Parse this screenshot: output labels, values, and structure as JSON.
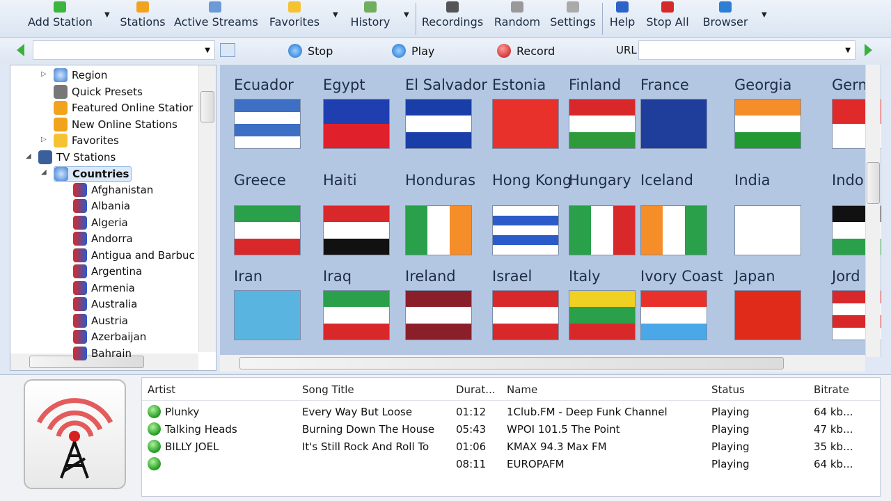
{
  "toolbar": {
    "items": [
      {
        "label": "Add Station",
        "icon": "add-icon",
        "color": "#3bb53b",
        "dropdown": true
      },
      {
        "label": "Stations",
        "icon": "stations-icon",
        "color": "#f2a31e",
        "dropdown": false
      },
      {
        "label": "Active Streams",
        "icon": "list-icon",
        "color": "#6a9ad8",
        "dropdown": false
      },
      {
        "label": "Favorites",
        "icon": "star-icon",
        "color": "#f5c232",
        "dropdown": true
      },
      {
        "label": "History",
        "icon": "history-icon",
        "color": "#6fae5c",
        "dropdown": true
      },
      {
        "label": "Recordings",
        "icon": "recordings-icon",
        "color": "#555555",
        "dropdown": false
      },
      {
        "label": "Random",
        "icon": "random-icon",
        "color": "#999999",
        "dropdown": false
      },
      {
        "label": "Settings",
        "icon": "wrench-icon",
        "color": "#aaaaaa",
        "dropdown": false
      },
      {
        "label": "Help",
        "icon": "help-icon",
        "color": "#2b63c8",
        "dropdown": false
      },
      {
        "label": "Stop All",
        "icon": "stop-icon",
        "color": "#d42a2a",
        "dropdown": false
      },
      {
        "label": "Browser",
        "icon": "ie-icon",
        "color": "#2d7fd6",
        "dropdown": true
      }
    ]
  },
  "player": {
    "stop": "Stop",
    "play": "Play",
    "record": "Record",
    "url_label": "URL",
    "url_value": "",
    "station_value": ""
  },
  "tree": [
    {
      "label": "Region",
      "level": 2,
      "icon": "globe-icon",
      "expander": "collapsed"
    },
    {
      "label": "Quick Presets",
      "level": 2,
      "icon": "presets-icon"
    },
    {
      "label": "Featured Online Statior",
      "level": 2,
      "icon": "stations-icon"
    },
    {
      "label": "New Online Stations",
      "level": 2,
      "icon": "stations-icon"
    },
    {
      "label": "Favorites",
      "level": 2,
      "icon": "star-icon",
      "expander": "collapsed"
    },
    {
      "label": "TV Stations",
      "level": 1,
      "icon": "monitor-icon",
      "expander": "expanded"
    },
    {
      "label": "Countries",
      "level": 2,
      "icon": "globe-icon",
      "expander": "expanded",
      "selected": true
    },
    {
      "label": "Afghanistan",
      "level": 3,
      "icon": "flag-icon"
    },
    {
      "label": "Albania",
      "level": 3,
      "icon": "flag-icon"
    },
    {
      "label": "Algeria",
      "level": 3,
      "icon": "flag-icon"
    },
    {
      "label": "Andorra",
      "level": 3,
      "icon": "flag-icon"
    },
    {
      "label": "Antigua and Barbuc",
      "level": 3,
      "icon": "flag-icon"
    },
    {
      "label": "Argentina",
      "level": 3,
      "icon": "flag-icon"
    },
    {
      "label": "Armenia",
      "level": 3,
      "icon": "flag-icon"
    },
    {
      "label": "Australia",
      "level": 3,
      "icon": "flag-icon"
    },
    {
      "label": "Austria",
      "level": 3,
      "icon": "flag-icon"
    },
    {
      "label": "Azerbaijan",
      "level": 3,
      "icon": "flag-icon"
    },
    {
      "label": "Bahrain",
      "level": 3,
      "icon": "flag-icon"
    }
  ],
  "grid": [
    [
      {
        "name": "Ecuador",
        "dir": "h",
        "colors": [
          "#3d6fc4",
          "#ffffff",
          "#3d6fc4",
          "#ffffff"
        ]
      },
      {
        "name": "Egypt",
        "dir": "h",
        "colors": [
          "#1f3fb0",
          "#e0202a"
        ]
      },
      {
        "name": "El Salvador",
        "dir": "h",
        "colors": [
          "#1a3ea8",
          "#ffffff",
          "#1a3ea8"
        ]
      },
      {
        "name": "Estonia",
        "dir": "h",
        "colors": [
          "#e8312a"
        ]
      },
      {
        "name": "Finland",
        "dir": "h",
        "colors": [
          "#d8282a",
          "#ffffff",
          "#2f9a3a"
        ]
      },
      {
        "name": "France",
        "dir": "h",
        "colors": [
          "#1f3e9c"
        ]
      },
      {
        "name": "Georgia",
        "dir": "h",
        "colors": [
          "#f58d28",
          "#ffffff",
          "#229933"
        ]
      },
      {
        "name": "Germ",
        "dir": "h",
        "colors": [
          "#e02a2a",
          "#ffffff"
        ]
      }
    ],
    [
      {
        "name": "Greece",
        "dir": "h",
        "colors": [
          "#2aa04a",
          "#ffffff",
          "#d8282a"
        ]
      },
      {
        "name": "Haiti",
        "dir": "h",
        "colors": [
          "#d8282a",
          "#ffffff",
          "#111111"
        ]
      },
      {
        "name": "Honduras",
        "dir": "v",
        "colors": [
          "#2aa04a",
          "#ffffff",
          "#f58d28"
        ]
      },
      {
        "name": "Hong Kong",
        "dir": "h",
        "colors": [
          "#ffffff",
          "#2b5bc8",
          "#ffffff",
          "#2b5bc8",
          "#ffffff"
        ]
      },
      {
        "name": "Hungary",
        "dir": "v",
        "colors": [
          "#2aa04a",
          "#ffffff",
          "#d8282a"
        ]
      },
      {
        "name": "Iceland",
        "dir": "v",
        "colors": [
          "#f58d28",
          "#ffffff",
          "#2aa04a"
        ]
      },
      {
        "name": "India",
        "dir": "h",
        "colors": [
          "#ffffff"
        ]
      },
      {
        "name": "Indo",
        "dir": "h",
        "colors": [
          "#111111",
          "#ffffff",
          "#2aa04a"
        ]
      }
    ],
    [
      {
        "name": "Iran",
        "dir": "h",
        "colors": [
          "#5ab4e0"
        ]
      },
      {
        "name": "Iraq",
        "dir": "h",
        "colors": [
          "#2aa04a",
          "#ffffff",
          "#d8282a"
        ]
      },
      {
        "name": "Ireland",
        "dir": "h",
        "colors": [
          "#8a1f2a",
          "#ffffff",
          "#8a1f2a"
        ]
      },
      {
        "name": "Israel",
        "dir": "h",
        "colors": [
          "#d8282a",
          "#ffffff",
          "#d8282a"
        ]
      },
      {
        "name": "Italy",
        "dir": "h",
        "colors": [
          "#f0d020",
          "#2aa04a",
          "#d8282a"
        ]
      },
      {
        "name": "Ivory Coast",
        "dir": "h",
        "colors": [
          "#e8312a",
          "#ffffff",
          "#4aa8e8"
        ]
      },
      {
        "name": "Japan",
        "dir": "h",
        "colors": [
          "#e02a1a"
        ]
      },
      {
        "name": "Jord",
        "dir": "h",
        "colors": [
          "#d8282a",
          "#ffffff",
          "#d8282a",
          "#ffffff"
        ]
      }
    ]
  ],
  "table": {
    "columns": [
      "Artist",
      "Song Title",
      "Durat...",
      "Name",
      "Status",
      "Bitrate"
    ],
    "rows": [
      {
        "artist": "Plunky",
        "song": "Every Way But Loose",
        "duration": "01:12",
        "name": "1Club.FM - Deep Funk Channel",
        "status": "Playing",
        "bitrate": "64 kb..."
      },
      {
        "artist": "Talking Heads",
        "song": "Burning Down The House",
        "duration": "05:43",
        "name": "WPOI 101.5 The Point",
        "status": "Playing",
        "bitrate": "47 kb..."
      },
      {
        "artist": "BILLY JOEL",
        "song": "It's Still Rock And Roll To",
        "duration": "01:06",
        "name": "KMAX 94.3 Max FM",
        "status": "Playing",
        "bitrate": "35 kb..."
      },
      {
        "artist": "",
        "song": "",
        "duration": "08:11",
        "name": "EUROPAFM",
        "status": "Playing",
        "bitrate": "64 kb..."
      }
    ]
  }
}
